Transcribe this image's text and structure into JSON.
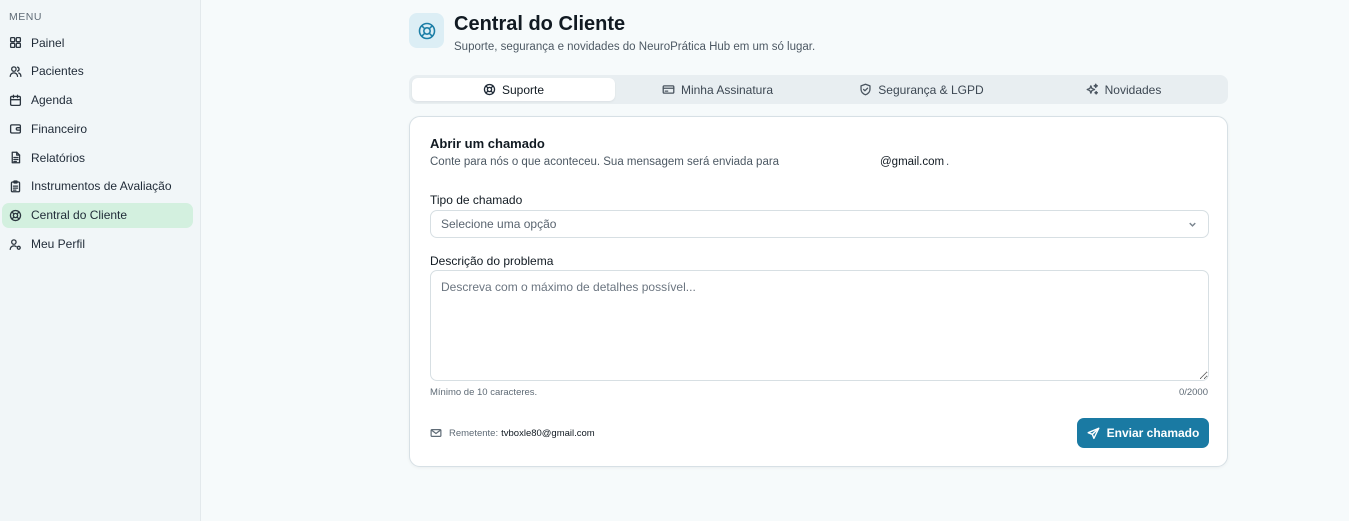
{
  "sidebar": {
    "menu_label": "MENU",
    "items": [
      {
        "label": "Painel",
        "icon": "dashboard-icon"
      },
      {
        "label": "Pacientes",
        "icon": "users-icon"
      },
      {
        "label": "Agenda",
        "icon": "calendar-icon"
      },
      {
        "label": "Financeiro",
        "icon": "wallet-icon"
      },
      {
        "label": "Relatórios",
        "icon": "report-icon"
      },
      {
        "label": "Instrumentos de Avaliação",
        "icon": "clipboard-icon"
      },
      {
        "label": "Central do Cliente",
        "icon": "lifebuoy-icon",
        "active": true
      },
      {
        "label": "Meu Perfil",
        "icon": "user-gear-icon"
      }
    ]
  },
  "header": {
    "icon": "lifebuoy-icon",
    "title": "Central do Cliente",
    "subtitle": "Suporte, segurança e novidades do NeuroPrática Hub em um só lugar."
  },
  "tabs": [
    {
      "label": "Suporte",
      "icon": "lifebuoy-icon",
      "active": true
    },
    {
      "label": "Minha Assinatura",
      "icon": "credit-card-icon"
    },
    {
      "label": "Segurança & LGPD",
      "icon": "shield-icon"
    },
    {
      "label": "Novidades",
      "icon": "sparkles-icon"
    }
  ],
  "form": {
    "title": "Abrir um chamado",
    "description": "Conte para nós o que aconteceu. Sua mensagem será enviada para",
    "email": "@gmail.com",
    "email_suffix": ".",
    "type_label": "Tipo de chamado",
    "type_value": "Selecione uma opção",
    "desc_label": "Descrição do problema",
    "desc_placeholder": "Descreva com o máximo de detalhes possível...",
    "hint": "Mínimo de 10 caracteres.",
    "counter": "0/2000",
    "sender_label": "Remetente:",
    "sender_value": "tvboxle80@gmail.com",
    "submit_label": "Enviar chamado"
  },
  "colors": {
    "accent": "#1a7aa3",
    "active_nav_bg": "#d3f0df",
    "page_bg": "#f6fafb"
  }
}
